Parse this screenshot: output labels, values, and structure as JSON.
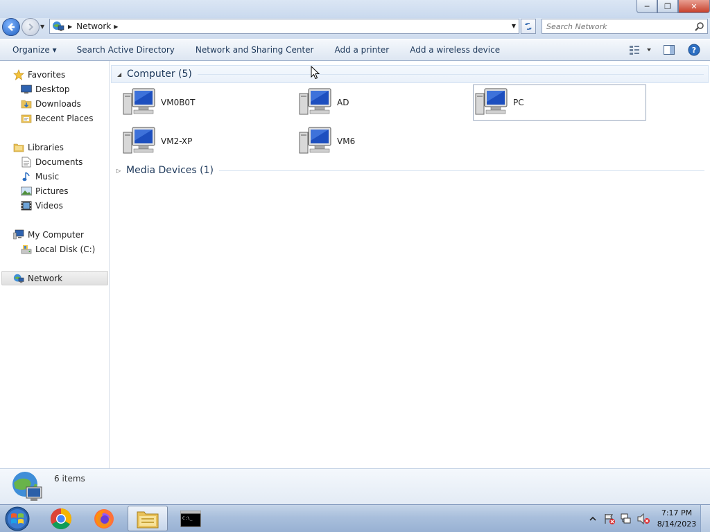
{
  "window": {
    "controls": {
      "minimize": "─",
      "restore": "❐",
      "close": "✕"
    }
  },
  "address": {
    "path": "Network",
    "search_placeholder": "Search Network"
  },
  "toolbar": {
    "organize": "Organize ▾",
    "search_ad": "Search Active Directory",
    "network_center": "Network and Sharing Center",
    "add_printer": "Add a printer",
    "add_wireless": "Add a wireless device"
  },
  "nav": {
    "favorites": "Favorites",
    "desktop": "Desktop",
    "downloads": "Downloads",
    "recent": "Recent Places",
    "libraries": "Libraries",
    "documents": "Documents",
    "music": "Music",
    "pictures": "Pictures",
    "videos": "Videos",
    "my_computer": "My Computer",
    "local_disk": "Local Disk (C:)",
    "network": "Network"
  },
  "groups": {
    "computer": "Computer (5)",
    "media": "Media Devices (1)"
  },
  "computers": [
    "VM0B0T",
    "AD",
    "PC",
    "VM2-XP",
    "VM6"
  ],
  "details": {
    "count": "6 items"
  },
  "clock": {
    "time": "7:17 PM",
    "date": "8/14/2023"
  },
  "colors": {
    "accent": "#1e395b",
    "toolbar_bg": "#dde6f2",
    "group_header_bg": "#eaf1fa"
  }
}
